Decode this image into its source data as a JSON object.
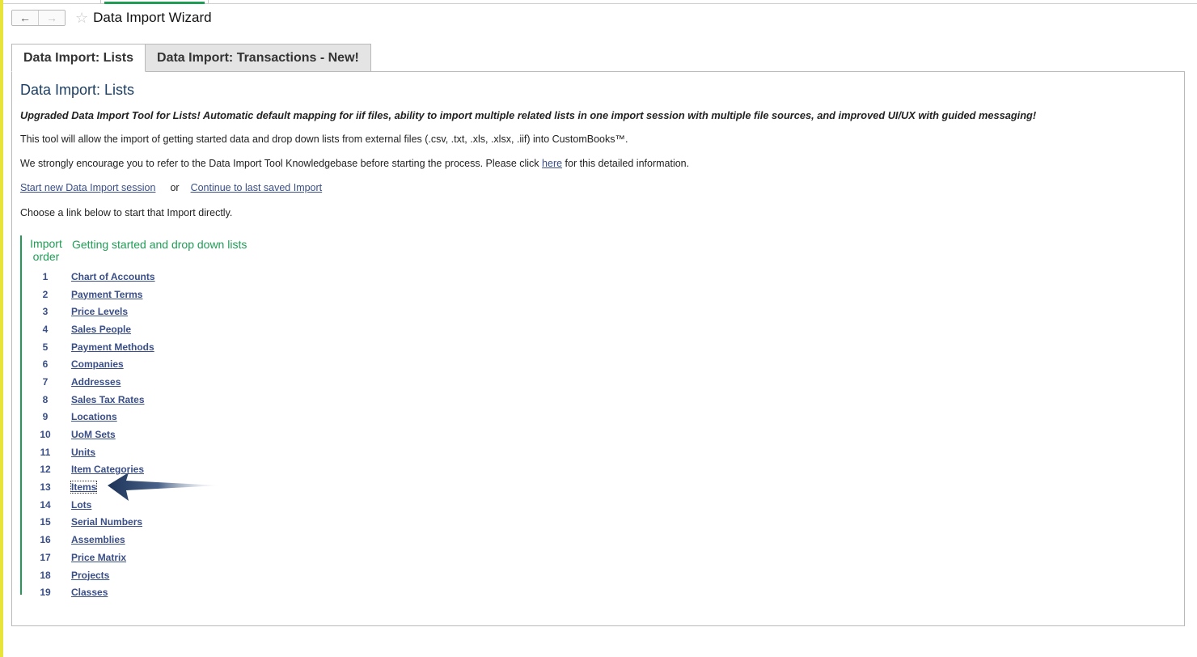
{
  "window": {
    "title": "Data Import Wizard",
    "nav_back": "←",
    "nav_forward": "→",
    "favorite_icon": "☆"
  },
  "tabs": [
    {
      "label": "Data Import: Lists",
      "active": true
    },
    {
      "label": "Data Import: Transactions - New!",
      "active": false
    }
  ],
  "content": {
    "heading": "Data Import: Lists",
    "upgrade_note": "Upgraded Data Import Tool for Lists! Automatic default mapping for iif files, ability to import multiple related lists in one import session with multiple file sources, and improved UI/UX with guided messaging!",
    "intro": "This tool will allow the import of getting started data and drop down lists from external files (.csv, .txt, .xls, .xlsx, .iif) into CustomBooks™.",
    "kb_pre": "We strongly encourage you to refer to the Data Import Tool Knowledgebase before starting the process. Please click ",
    "kb_link": "here",
    "kb_post": " for this detailed information.",
    "start_link": "Start new Data Import session",
    "or_text": "or",
    "continue_link": "Continue to last saved Import",
    "choose_text": "Choose a link below to start that Import directly."
  },
  "import_list": {
    "order_header": "Import order",
    "title_header": "Getting started and drop down lists",
    "items": [
      {
        "num": "1",
        "label": "Chart of Accounts"
      },
      {
        "num": "2",
        "label": "Payment Terms"
      },
      {
        "num": "3",
        "label": "Price Levels"
      },
      {
        "num": "4",
        "label": "Sales People"
      },
      {
        "num": "5",
        "label": "Payment Methods"
      },
      {
        "num": "6",
        "label": "Companies"
      },
      {
        "num": "7",
        "label": "Addresses"
      },
      {
        "num": "8",
        "label": "Sales Tax Rates"
      },
      {
        "num": "9",
        "label": "Locations"
      },
      {
        "num": "10",
        "label": "UoM Sets"
      },
      {
        "num": "11",
        "label": "Units"
      },
      {
        "num": "12",
        "label": "Item Categories"
      },
      {
        "num": "13",
        "label": "Items",
        "focused": true
      },
      {
        "num": "14",
        "label": "Lots"
      },
      {
        "num": "15",
        "label": "Serial Numbers"
      },
      {
        "num": "16",
        "label": "Assemblies"
      },
      {
        "num": "17",
        "label": "Price Matrix"
      },
      {
        "num": "18",
        "label": "Projects"
      },
      {
        "num": "19",
        "label": "Classes"
      }
    ]
  },
  "colors": {
    "accent_green": "#1f9d55",
    "link_blue": "#3a4f87",
    "heading_blue": "#1c3f66",
    "arrow_navy": "#1d3358"
  }
}
